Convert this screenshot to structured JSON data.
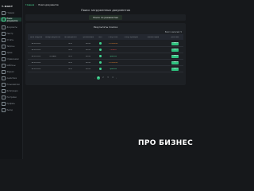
{
  "sidebar": {
    "logo": "Т.ФАКТ",
    "items": [
      {
        "label": "Главная"
      },
      {
        "label": "Поиск документов"
      },
      {
        "label": "Документы"
      },
      {
        "label": "Реестр"
      },
      {
        "label": "Отчёты"
      },
      {
        "label": "Запросы"
      },
      {
        "label": "Архив"
      },
      {
        "label": "Справочники"
      },
      {
        "label": "Шаблоны"
      },
      {
        "label": "Журнал"
      },
      {
        "label": "Аналитика"
      },
      {
        "label": "Пользователи"
      },
      {
        "label": "Интеграции"
      },
      {
        "label": "Настройки"
      },
      {
        "label": "Профиль"
      },
      {
        "label": "Выход"
      }
    ]
  },
  "breadcrumb": {
    "home": "Главная",
    "sep": "›",
    "current": "Поиск документов"
  },
  "page_title": "Поиск загруженных документов",
  "tabs": [
    {
      "label": "Поиск по реквизитам"
    }
  ],
  "results": {
    "title": "Результаты поиска",
    "extra_header": "Всего записей: 5",
    "columns": [
      "Дата загрузки",
      "Номер документа",
      "Тип документа",
      "Организация",
      "ЭЦП",
      "Статус ФНС",
      "Статус проверки",
      "Комментарий",
      "Действие"
    ],
    "rows": [
      {
        "date": "08.09.2023",
        "number": "",
        "type": "ЭСФ",
        "org": "00752",
        "sig": "",
        "status": "Отклонено",
        "status_class": "status-orange",
        "comment": "",
        "action": "Открыть"
      },
      {
        "date": "08.09.2023",
        "number": "",
        "type": "ЭСФ",
        "org": "00752",
        "sig": "",
        "status": "Ошибка",
        "status_class": "status-red",
        "comment": "",
        "action": "Открыть"
      },
      {
        "date": "08.09.2023",
        "number": "ЭСФ888",
        "type": "ЭСФ",
        "org": "00752",
        "sig": "",
        "status": "Принято",
        "status_class": "status-green",
        "comment": "",
        "action": "Открыть"
      },
      {
        "date": "08.09.2023",
        "number": "",
        "type": "ЭСФ",
        "org": "00752",
        "sig": "",
        "status": "Отклонено",
        "status_class": "status-orange",
        "comment": "",
        "action": "Открыть"
      },
      {
        "date": "08.09.2023",
        "number": "",
        "type": "ЭСФ",
        "org": "00752",
        "sig": "",
        "status": "Принято",
        "status_class": "status-green",
        "comment": "",
        "action": "Открыть"
      }
    ]
  },
  "pagination": {
    "pages": [
      "1",
      "2",
      "3",
      "4"
    ],
    "current": "1",
    "prev": "‹",
    "next": "›"
  },
  "watermark": "ПРО БИЗНЕС",
  "colors": {
    "accent": "#2ec27e",
    "background": "#16181b",
    "panel": "#1d2024"
  }
}
